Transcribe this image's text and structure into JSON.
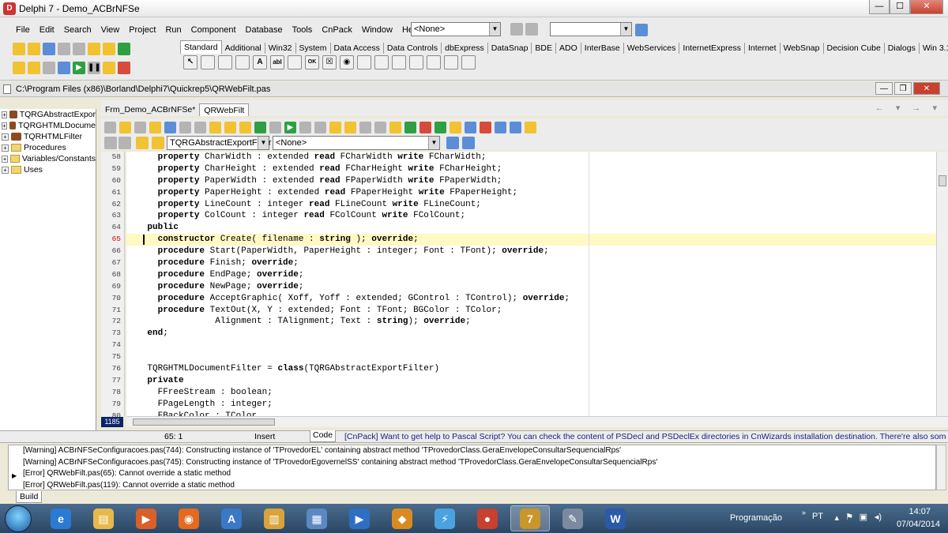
{
  "window": {
    "title": "Delphi 7 - Demo_ACBrNFSe",
    "controls": [
      "—",
      "☐",
      "✕"
    ]
  },
  "menu": [
    "File",
    "Edit",
    "Search",
    "View",
    "Project",
    "Run",
    "Component",
    "Database",
    "Tools",
    "CnPack",
    "Window",
    "Help"
  ],
  "toolbar": {
    "desktop_combo": "<None>",
    "second_combo": ""
  },
  "palette_tabs": [
    "Standard",
    "Additional",
    "Win32",
    "System",
    "Data Access",
    "Data Controls",
    "dbExpress",
    "DataSnap",
    "BDE",
    "ADO",
    "InterBase",
    "WebServices",
    "InternetExpress",
    "Internet",
    "WebSnap",
    "Decision Cube",
    "Dialogs",
    "Win 3.1"
  ],
  "palette_icons": [
    "A",
    "abl",
    "OK",
    "☒",
    "◉"
  ],
  "path_bar": {
    "path": "C:\\Program Files (x86)\\Borland\\Delphi7\\Quickrep5\\QRWebFilt.pas"
  },
  "tree": [
    {
      "label": "TQRGAbstractExpor",
      "kind": "class"
    },
    {
      "label": "TQRGHTMLDocume",
      "kind": "class"
    },
    {
      "label": "TQRHTMLFilter",
      "kind": "class"
    },
    {
      "label": "Procedures",
      "kind": "folder"
    },
    {
      "label": "Variables/Constants",
      "kind": "folder"
    },
    {
      "label": "Uses",
      "kind": "folder"
    }
  ],
  "editor": {
    "tabs": [
      "Frm_Demo_ACBrNFSe*",
      "QRWebFilt"
    ],
    "active_tab": "QRWebFilt",
    "class_combo": "TQRGAbstractExportFilter",
    "method_combo": "<None>",
    "line_count_badge": "1185",
    "lines": [
      {
        "n": "58",
        "text": "      property CharWidth : extended read FCharWidth write FCharWidth;"
      },
      {
        "n": "59",
        "text": "      property CharHeight : extended read FCharHeight write FCharHeight;"
      },
      {
        "n": "60",
        "text": "      property PaperWidth : extended read FPaperWidth write FPaperWidth;"
      },
      {
        "n": "61",
        "text": "      property PaperHeight : extended read FPaperHeight write FPaperHeight;"
      },
      {
        "n": "62",
        "text": "      property LineCount : integer read FLineCount write FLineCount;"
      },
      {
        "n": "63",
        "text": "      property ColCount : integer read FColCount write FColCount;"
      },
      {
        "n": "64",
        "text": "    public"
      },
      {
        "n": "65",
        "text": "      constructor Create( filename : string ); override;",
        "current": true
      },
      {
        "n": "66",
        "text": "      procedure Start(PaperWidth, PaperHeight : integer; Font : TFont); override;"
      },
      {
        "n": "67",
        "text": "      procedure Finish; override;"
      },
      {
        "n": "68",
        "text": "      procedure EndPage; override;"
      },
      {
        "n": "69",
        "text": "      procedure NewPage; override;"
      },
      {
        "n": "70",
        "text": "      procedure AcceptGraphic( Xoff, Yoff : extended; GControl : TControl); override;"
      },
      {
        "n": "71",
        "text": "      procedure TextOut(X, Y : extended; Font : TFont; BGColor : TColor;"
      },
      {
        "n": "72",
        "text": "                 Alignment : TAlignment; Text : string); override;"
      },
      {
        "n": "73",
        "text": "    end;"
      },
      {
        "n": "74",
        "text": ""
      },
      {
        "n": "75",
        "text": ""
      },
      {
        "n": "76",
        "text": "    TQRGHTMLDocumentFilter = class(TQRGAbstractExportFilter)"
      },
      {
        "n": "77",
        "text": "    private"
      },
      {
        "n": "78",
        "text": "      FFreeStream : boolean;"
      },
      {
        "n": "79",
        "text": "      FPageLength : integer;"
      },
      {
        "n": "80",
        "text": "      FBackColor : TColor"
      }
    ]
  },
  "status": {
    "position": "65:  1",
    "mode": "Insert",
    "tab": "Code",
    "hint": "[CnPack] Want to get help to Pascal Script? You can check the content of PSDecl and PSDeclEx directories in CnWizards installation destination. There're also some demos in PSDe..."
  },
  "messages": [
    {
      "text": "[Warning] ACBrNFSeConfiguracoes.pas(744): Constructing instance of 'TProvedorEL' containing abstract method 'TProvedorClass.GeraEnvelopeConsultarSequencialRps'",
      "selected": false
    },
    {
      "text": "[Warning] ACBrNFSeConfiguracoes.pas(745): Constructing instance of 'TProvedorEgovernelSS' containing abstract method 'TProvedorClass.GeraEnvelopeConsultarSequencialRps'",
      "selected": false
    },
    {
      "text": "[Error] QRWebFilt.pas(65): Cannot override a static method",
      "selected": true
    },
    {
      "text": "[Error] QRWebFilt.pas(119): Cannot override a static method",
      "selected": false
    }
  ],
  "messages_tab": "Build",
  "taskbar": {
    "tray_label": "Programação",
    "lang": "PT",
    "time": "14:07",
    "date": "07/04/2014",
    "apps": [
      {
        "name": "ie",
        "glyph": "e",
        "color": "#2a7bd4"
      },
      {
        "name": "folder",
        "glyph": "▤",
        "color": "#e8b84a"
      },
      {
        "name": "media",
        "glyph": "▶",
        "color": "#d9602b"
      },
      {
        "name": "firefox",
        "glyph": "◉",
        "color": "#e56a1f"
      },
      {
        "name": "app-a",
        "glyph": "A",
        "color": "#3a78c8"
      },
      {
        "name": "explorer",
        "glyph": "▥",
        "color": "#d9a33a"
      },
      {
        "name": "remote",
        "glyph": "▦",
        "color": "#5c88c4"
      },
      {
        "name": "wmp",
        "glyph": "▶",
        "color": "#2d6fc2"
      },
      {
        "name": "fox",
        "glyph": "◆",
        "color": "#d98b22"
      },
      {
        "name": "bolt",
        "glyph": "⚡",
        "color": "#4aa3e0"
      },
      {
        "name": "chrome",
        "glyph": "●",
        "color": "#c8402e"
      },
      {
        "name": "delphi",
        "glyph": "7",
        "color": "#c8962a"
      },
      {
        "name": "paint",
        "glyph": "✎",
        "color": "#7b8aa0"
      },
      {
        "name": "word",
        "glyph": "W",
        "color": "#2b5aa8"
      }
    ]
  }
}
